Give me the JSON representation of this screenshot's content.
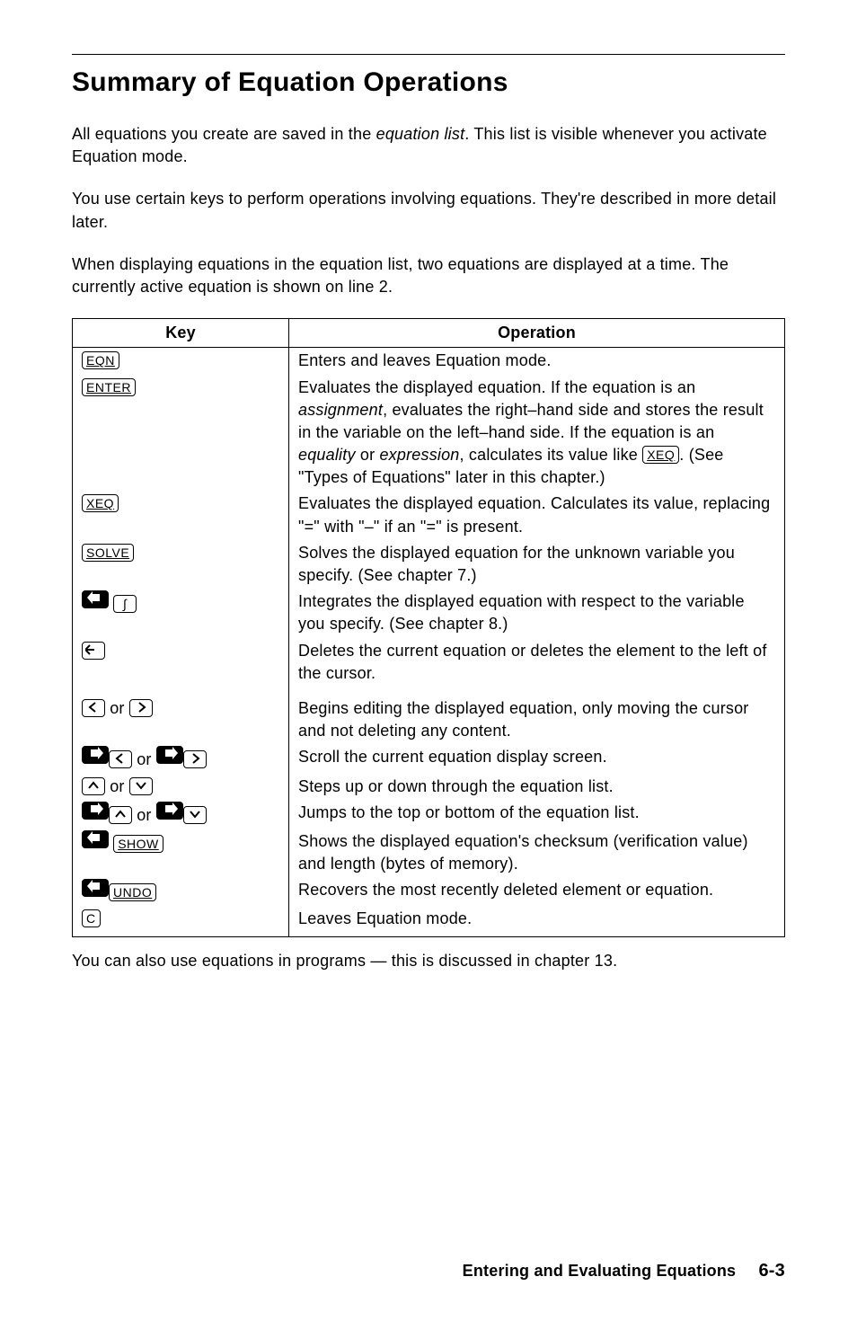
{
  "title": "Summary of Equation Operations",
  "para1a": "All equations you create are saved in the ",
  "para1b": "equation list",
  "para1c": ". This list is visible whenever you activate Equation mode.",
  "para2": "You use certain keys to perform operations involving equations. They're described in more detail later.",
  "para3": "When displaying equations in the equation list, two equations are displayed at a time. The currently active equation is shown on line 2.",
  "th_key": "Key",
  "th_op": "Operation",
  "rows": {
    "eqn_key": "EQN",
    "eqn_op": "Enters and leaves Equation mode.",
    "enter_key": "ENTER",
    "enter_op_a": "Evaluates the displayed equation. If the equation is an ",
    "enter_op_b": "assignment",
    "enter_op_c": ", evaluates the right–hand side and stores the result in the variable on the left–hand side. If the equation is an ",
    "enter_op_d": "equality",
    "enter_op_e": " or ",
    "enter_op_f": "expression",
    "enter_op_g": ", calculates its value like ",
    "enter_op_h": "XEQ",
    "enter_op_i": ". (See \"Types of Equations\" later in this chapter.)",
    "xeq_key": "XEQ",
    "xeq_op": "Evaluates the displayed equation. Calculates its value, replacing \"=\" with \"–\" if an \"=\" is present.",
    "solve_key": "SOLVE",
    "solve_op": "Solves the displayed equation for the unknown variable you specify. (See chapter 7.)",
    "int_key": "∫",
    "int_op": "Integrates the displayed equation with respect to the variable you specify. (See chapter 8.)",
    "bksp_op": "Deletes the current equation or deletes the element to the left of the cursor.",
    "lr_or": " or ",
    "lr_op": "Begins editing the displayed equation, only moving the cursor and not deleting any content.",
    "scroll_op": "Scroll the current equation display screen.",
    "updn_op": "Steps up or down through the equation list.",
    "jump_op": "Jumps to the top or bottom of the equation list.",
    "show_key": "SHOW",
    "show_op": "Shows the displayed equation's checksum (verification value) and length (bytes of memory).",
    "undo_key": "UNDO",
    "undo_op": "Recovers the most recently deleted element or equation.",
    "c_key": "C",
    "c_op": "Leaves Equation mode."
  },
  "outro": "You can also use equations in programs — this is discussed in chapter 13.",
  "footer_title": "Entering and Evaluating Equations",
  "footer_page": "6-3"
}
